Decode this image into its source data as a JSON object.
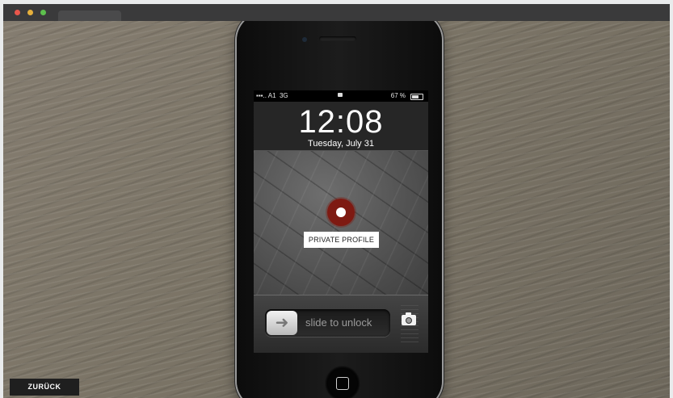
{
  "window": {
    "tab_label": ""
  },
  "status_bar": {
    "carrier": "A1",
    "network": "3G",
    "battery": "67 %",
    "battery_level": 0.67
  },
  "lock_screen": {
    "time": "12:08",
    "date": "Tuesday, July 31"
  },
  "profile_button": {
    "label": "PRIVATE PROFILE"
  },
  "unlock": {
    "label": "slide to unlock",
    "knob_icon": "arrow-right-icon"
  },
  "nav": {
    "back_label": "ZURÜCK"
  },
  "colors": {
    "pin": "#7e1a12",
    "background": "#7b7466"
  }
}
